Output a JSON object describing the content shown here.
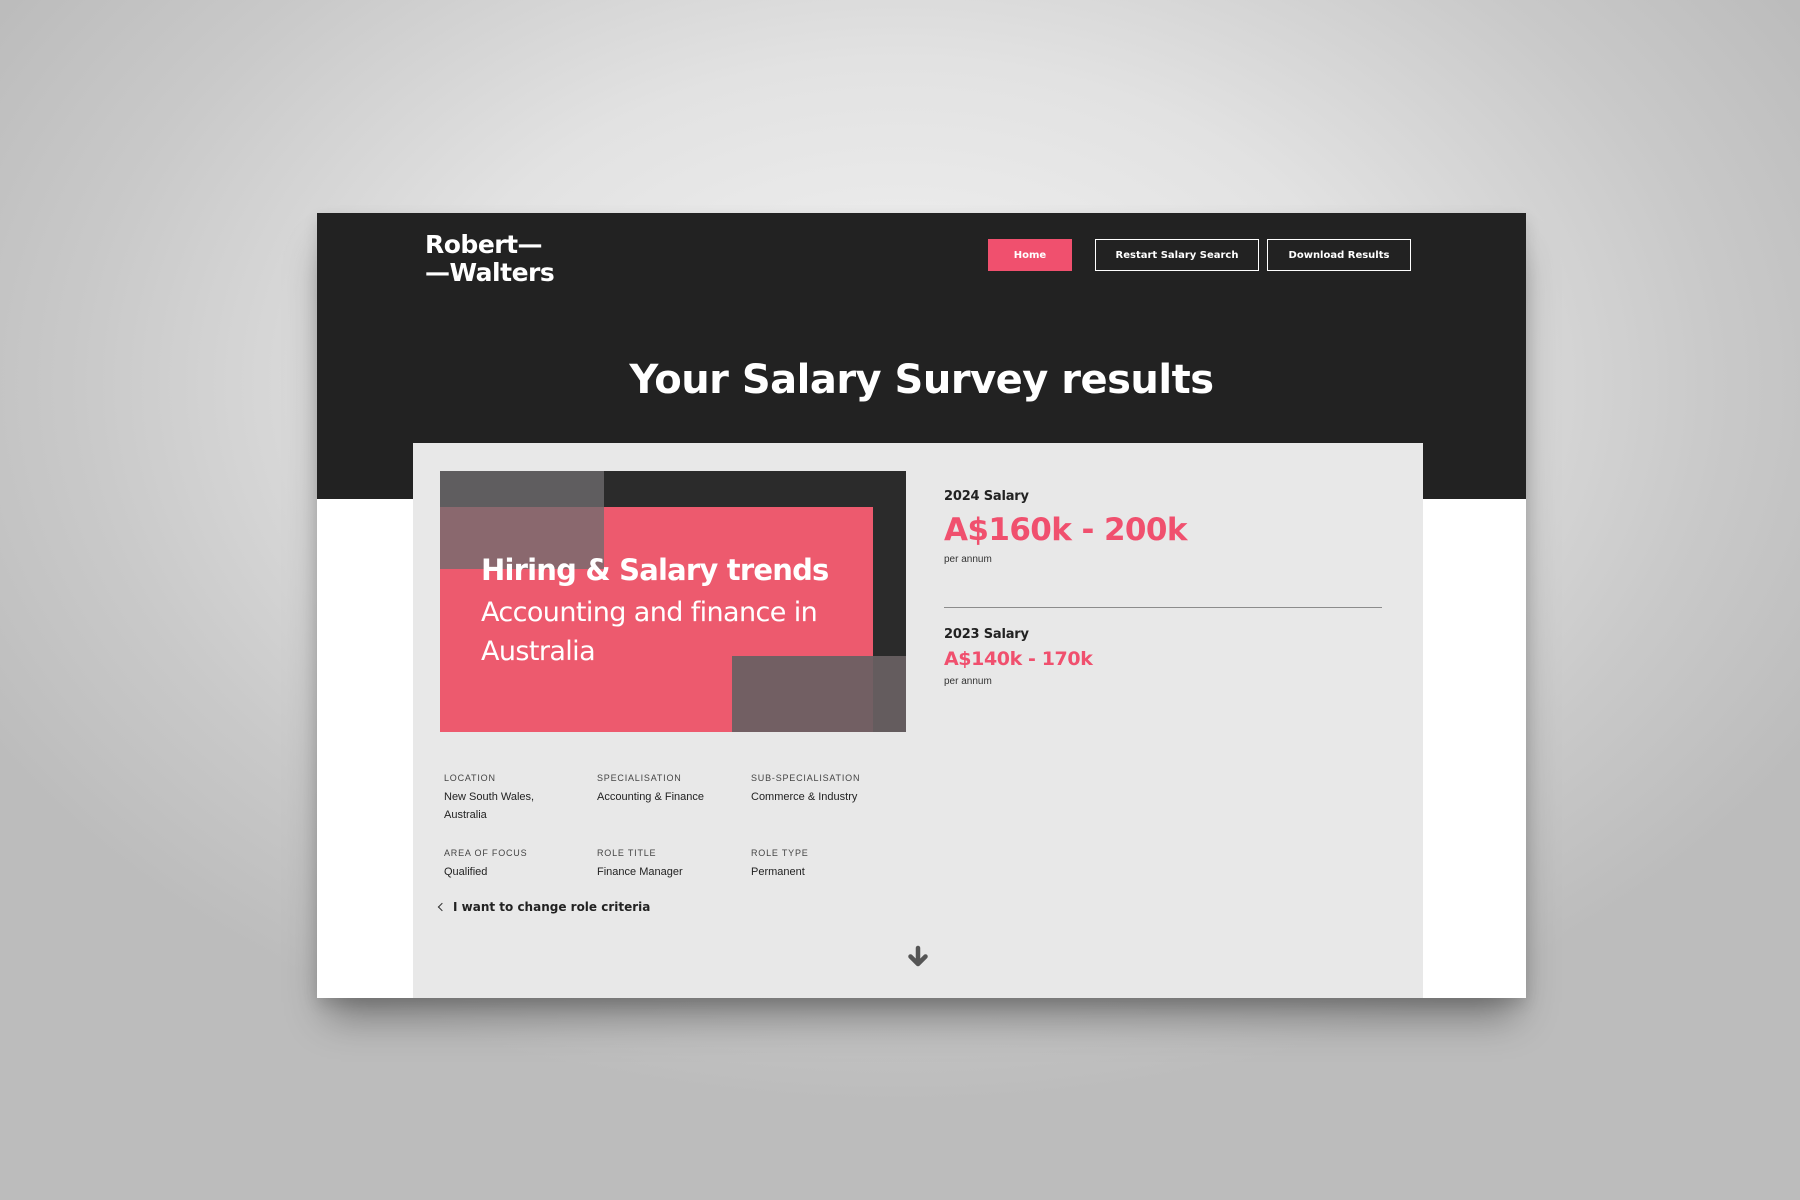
{
  "header": {
    "logo_text": "Robert—\n—Walters",
    "nav": {
      "home": "Home",
      "restart": "Restart Salary Search",
      "download": "Download Results"
    },
    "page_title": "Your Salary Survey results"
  },
  "banner": {
    "heading": "Hiring & Salary trends",
    "subheading": "Accounting and finance in Australia"
  },
  "salary": {
    "current": {
      "label": "2024 Salary",
      "value": "A$160k - 200k",
      "period": "per annum"
    },
    "previous": {
      "label": "2023 Salary",
      "value": "A$140k - 170k",
      "period": "per annum"
    }
  },
  "criteria": [
    {
      "label": "Location",
      "value": "New South Wales, Australia"
    },
    {
      "label": "Specialisation",
      "value": "Accounting & Finance"
    },
    {
      "label": "Sub-specialisation",
      "value": "Commerce & Industry"
    },
    {
      "label": "Area of focus",
      "value": "Qualified"
    },
    {
      "label": "Role title",
      "value": "Finance Manager"
    },
    {
      "label": "Role type",
      "value": "Permanent"
    }
  ],
  "change_link": "I want to change role criteria",
  "icons": {
    "back": "chevron-left-icon",
    "scroll": "arrow-down-icon"
  },
  "colors": {
    "accent": "#f0506e",
    "header_bg": "#222222",
    "card_bg": "#e8e8e8"
  }
}
